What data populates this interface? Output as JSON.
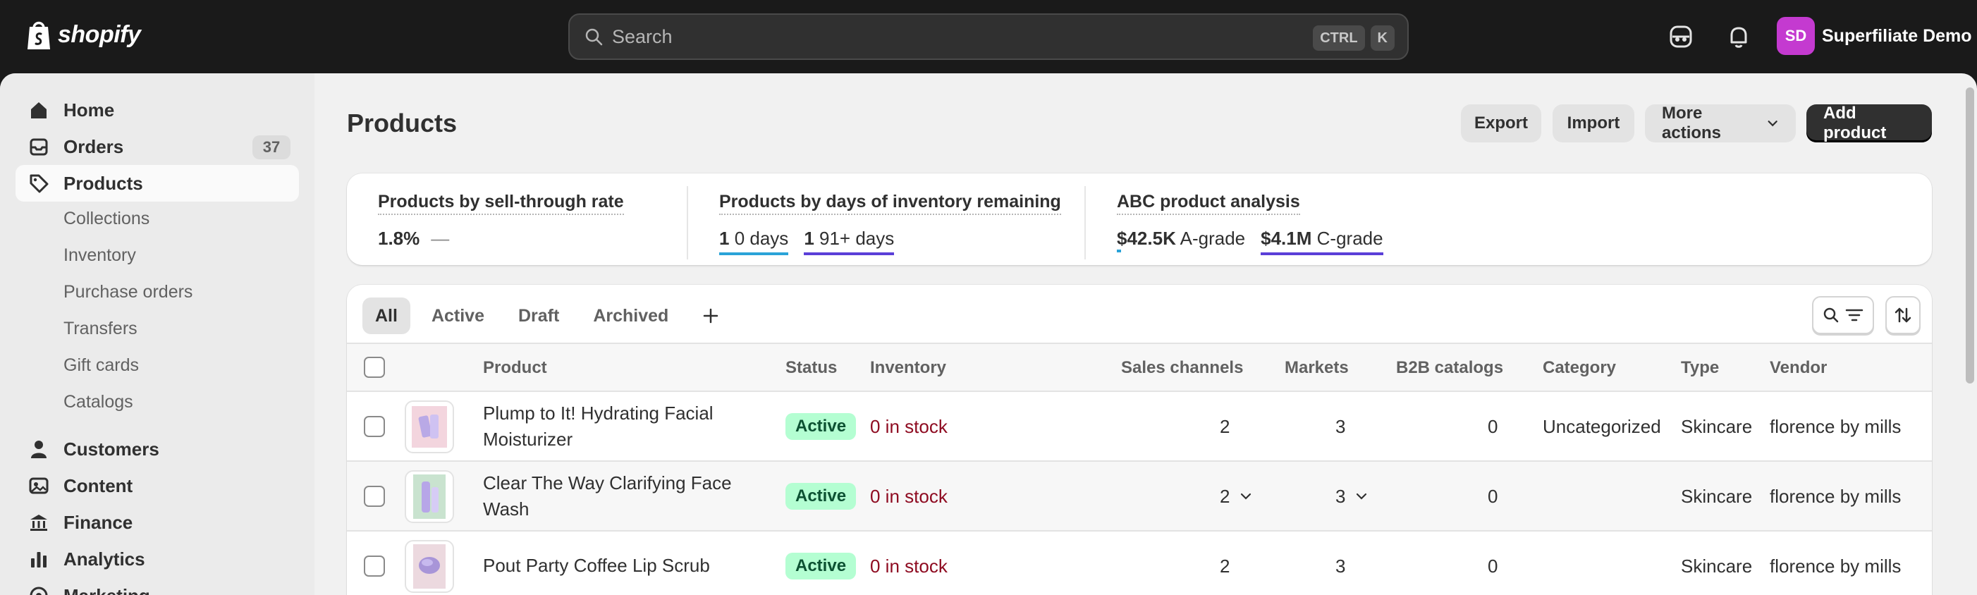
{
  "brand": {
    "name": "shopify"
  },
  "search": {
    "placeholder": "Search",
    "shortcut_ctrl": "CTRL",
    "shortcut_key": "K"
  },
  "account": {
    "initials": "SD",
    "name": "Superfiliate Demo"
  },
  "colors": {
    "accent": "#303030",
    "active_badge_bg": "#b4fed2",
    "out_of_stock": "#8e0b21",
    "avatar": "#c43ad0",
    "teal_bar": "#2aa3d8",
    "purple_bar": "#5b3fd8"
  },
  "sidebar": {
    "items": [
      {
        "label": "Home",
        "icon": "home-icon"
      },
      {
        "label": "Orders",
        "icon": "orders-icon",
        "badge": "37"
      },
      {
        "label": "Products",
        "icon": "tag-icon"
      }
    ],
    "product_subitems": [
      "Collections",
      "Inventory",
      "Purchase orders",
      "Transfers",
      "Gift cards",
      "Catalogs"
    ],
    "lower_items": [
      {
        "label": "Customers",
        "icon": "person-icon"
      },
      {
        "label": "Content",
        "icon": "content-icon"
      },
      {
        "label": "Finance",
        "icon": "bank-icon"
      },
      {
        "label": "Analytics",
        "icon": "bar-chart-icon"
      },
      {
        "label": "Marketing",
        "icon": "target-icon"
      }
    ]
  },
  "header": {
    "title": "Products",
    "export_label": "Export",
    "import_label": "Import",
    "more_actions_label": "More actions",
    "add_product_label": "Add product"
  },
  "metrics": {
    "sell_through": {
      "title": "Products by sell-through rate",
      "value": "1.8%",
      "trend": "—"
    },
    "days_inventory": {
      "title": "Products by days of inventory remaining",
      "seg1_count": "1",
      "seg1_label": "0 days",
      "seg2_count": "1",
      "seg2_label": "91+ days"
    },
    "abc": {
      "title": "ABC product analysis",
      "seg1_value": "$42.5K",
      "seg1_label": "A-grade",
      "seg2_value": "$4.1M",
      "seg2_label": "C-grade"
    }
  },
  "tabs": [
    "All",
    "Active",
    "Draft",
    "Archived"
  ],
  "table": {
    "headers": [
      "Product",
      "Status",
      "Inventory",
      "Sales channels",
      "Markets",
      "B2B catalogs",
      "Category",
      "Type",
      "Vendor"
    ],
    "rows": [
      {
        "product": "Plump to It! Hydrating Facial Moisturizer",
        "status": "Active",
        "inventory": "0 in stock",
        "sales_channels": "2",
        "markets": "3",
        "b2b": "0",
        "category": "Uncategorized",
        "type": "Skincare",
        "vendor": "florence by mills"
      },
      {
        "product": "Clear The Way Clarifying Face Wash",
        "status": "Active",
        "inventory": "0 in stock",
        "sales_channels": "2",
        "markets": "3",
        "b2b": "0",
        "category": "",
        "type": "Skincare",
        "vendor": "florence by mills"
      },
      {
        "product": "Pout Party Coffee Lip Scrub",
        "status": "Active",
        "inventory": "0 in stock",
        "sales_channels": "2",
        "markets": "3",
        "b2b": "0",
        "category": "",
        "type": "Skincare",
        "vendor": "florence by mills"
      }
    ]
  }
}
